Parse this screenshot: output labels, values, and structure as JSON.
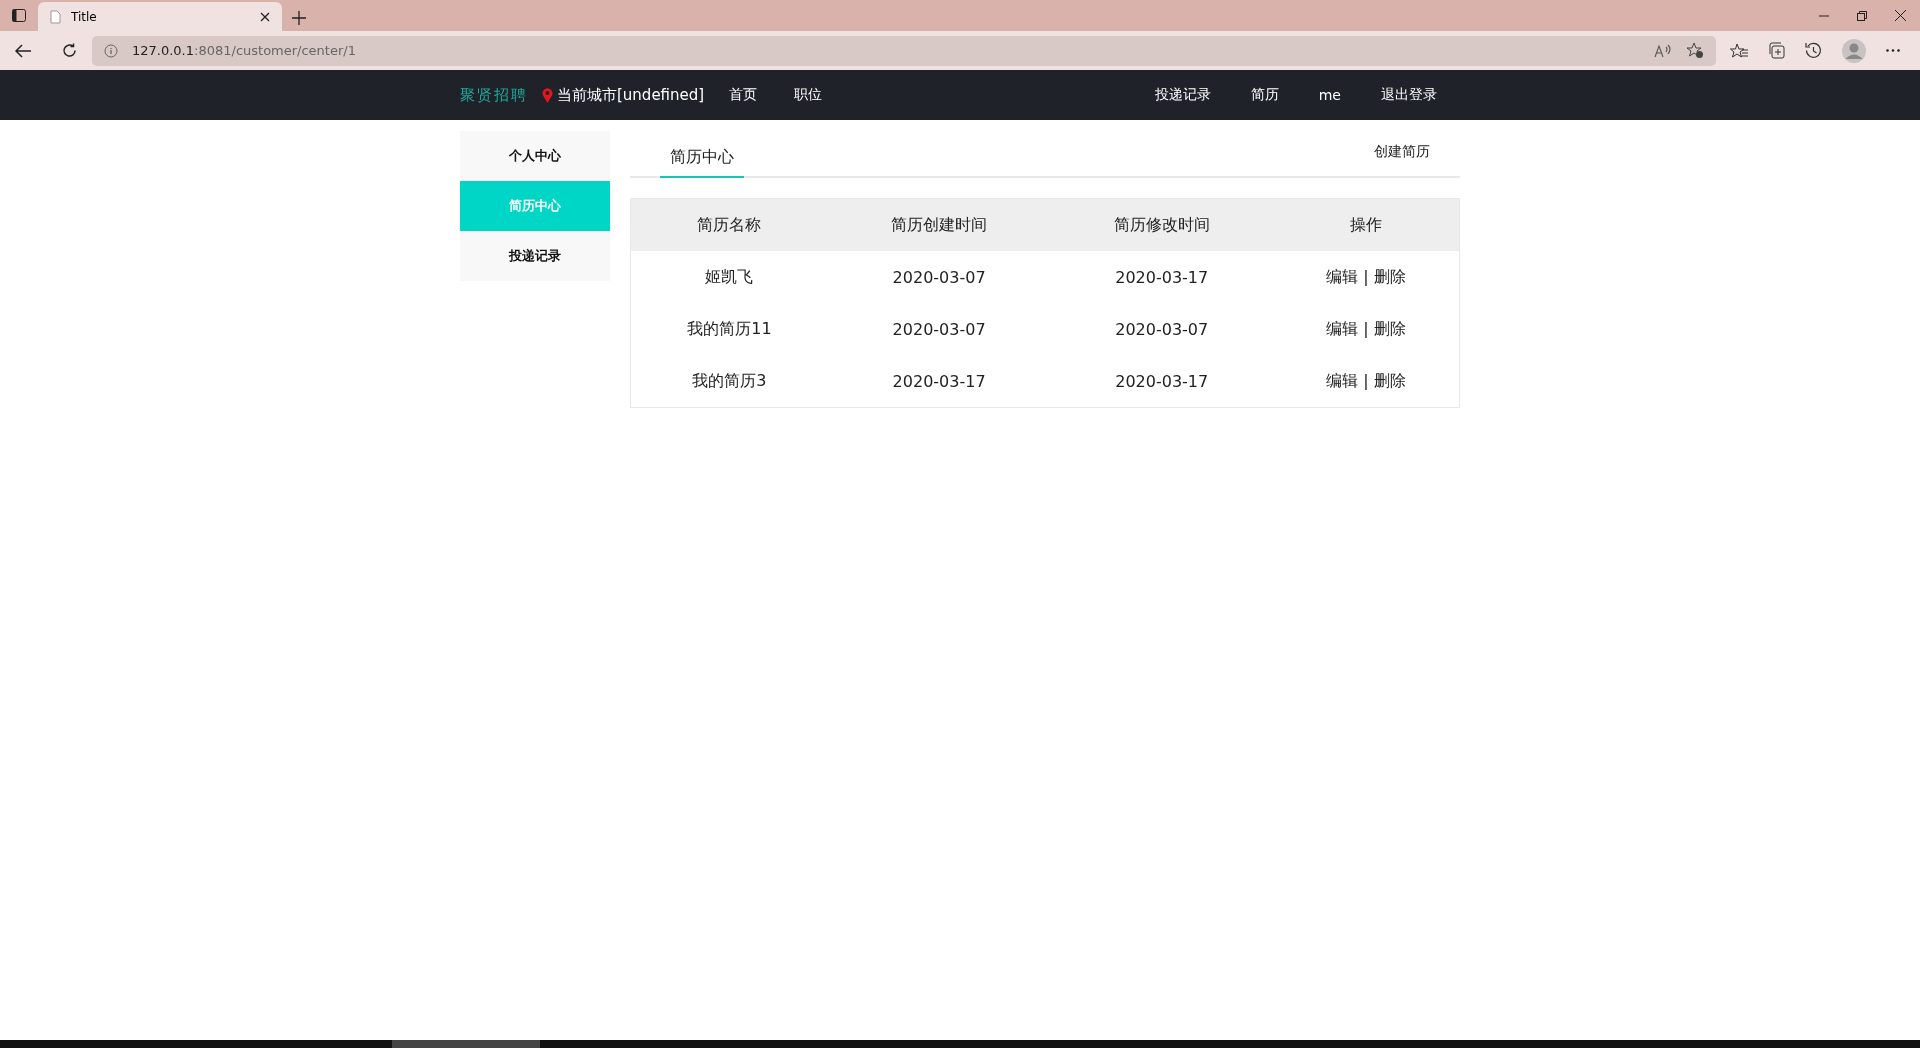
{
  "browser": {
    "tab_title": "Title",
    "url_host": "127.0.0.1",
    "url_path": ":8081/customer/center/1"
  },
  "navbar": {
    "logo": "聚贤招聘",
    "city": "当前城市[undefined]",
    "left_links": [
      "首页",
      "职位"
    ],
    "right_links": [
      "投递记录",
      "简历",
      "me",
      "退出登录"
    ]
  },
  "sidebar": {
    "items": [
      {
        "label": "个人中心",
        "selected": false
      },
      {
        "label": "简历中心",
        "selected": true
      },
      {
        "label": "投递记录",
        "selected": false
      }
    ]
  },
  "tabs": [
    {
      "label": "简历中心",
      "selected": true
    }
  ],
  "create_button": "创建简历",
  "table": {
    "columns": [
      "简历名称",
      "简历创建时间",
      "简历修改时间",
      "操作"
    ],
    "rows": [
      {
        "name": "姬凯飞",
        "created": "2020-03-07",
        "modified": "2020-03-17",
        "edit": "编辑",
        "separator": "|",
        "delete": "删除"
      },
      {
        "name": "我的简历11",
        "created": "2020-03-07",
        "modified": "2020-03-07",
        "edit": "编辑",
        "separator": "|",
        "delete": "删除"
      },
      {
        "name": "我的简历3",
        "created": "2020-03-17",
        "modified": "2020-03-17",
        "edit": "编辑",
        "separator": "|",
        "delete": "删除"
      }
    ]
  }
}
